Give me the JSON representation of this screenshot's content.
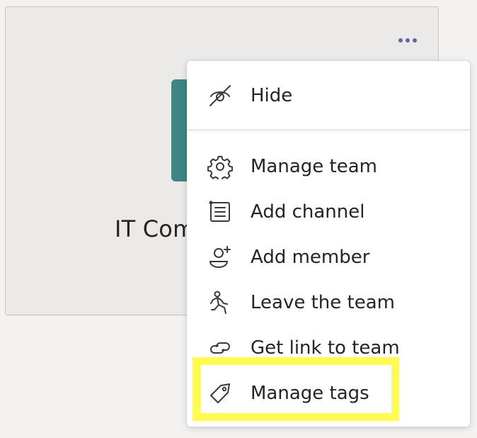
{
  "team": {
    "name": "IT Com",
    "avatar_color": "#3e8583",
    "more_options_icon": "more-horizontal-icon"
  },
  "menu": {
    "items": [
      {
        "label": "Hide",
        "icon": "eye-off-icon"
      },
      {
        "label": "Manage team",
        "icon": "gear-icon"
      },
      {
        "label": "Add channel",
        "icon": "channel-list-icon"
      },
      {
        "label": "Add member",
        "icon": "add-person-icon"
      },
      {
        "label": "Leave the team",
        "icon": "running-person-icon"
      },
      {
        "label": "Get link to team",
        "icon": "link-icon"
      },
      {
        "label": "Manage tags",
        "icon": "tag-icon"
      }
    ],
    "highlighted_item": "Manage tags"
  },
  "colors": {
    "accent": "#6264a7",
    "highlight": "#fffb50",
    "text": "#252423"
  }
}
